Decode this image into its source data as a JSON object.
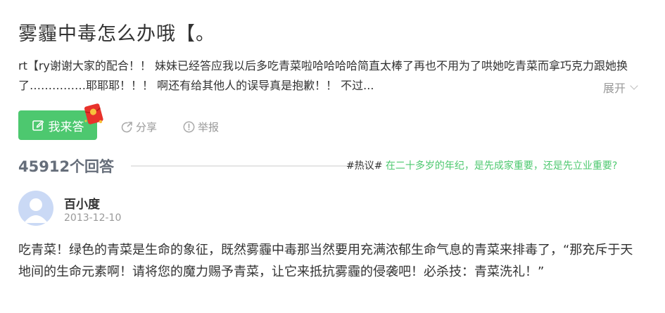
{
  "question": {
    "title": "雾霾中毒怎么办哦【。",
    "description": "rt【ry谢谢大家的配合！！ 妹妹已经答应我以后多吃青菜啦哈哈哈哈简直太棒了再也不用为了哄她吃青菜而拿巧克力跟她换了……………耶耶耶！！！ 啊还有给其他人的误导真是抱歉！！ 不过...",
    "expand_label": "展开"
  },
  "actions": {
    "answer_label": "我来答",
    "share_label": "分享",
    "report_label": "举报"
  },
  "answers": {
    "count_label": "45912个回答",
    "hot_prefix": "#热议#",
    "hot_topic": "在二十多岁的年纪，是先成家重要，还是先立业重要?"
  },
  "answer": {
    "username": "百小度",
    "date": "2013-12-10",
    "content": "吃青菜！绿色的青菜是生命的象征，既然雾霾中毒那当然要用充满浓郁生命气息的青菜来排毒了，“那充斥于天地间的生命元素啊！请将您的魔力赐予青菜，让它来抵抗雾霾的侵袭吧！必杀技：青菜洗礼！”"
  },
  "colors": {
    "accent": "#4dc86f",
    "muted": "#999999",
    "count": "#666e7a"
  }
}
